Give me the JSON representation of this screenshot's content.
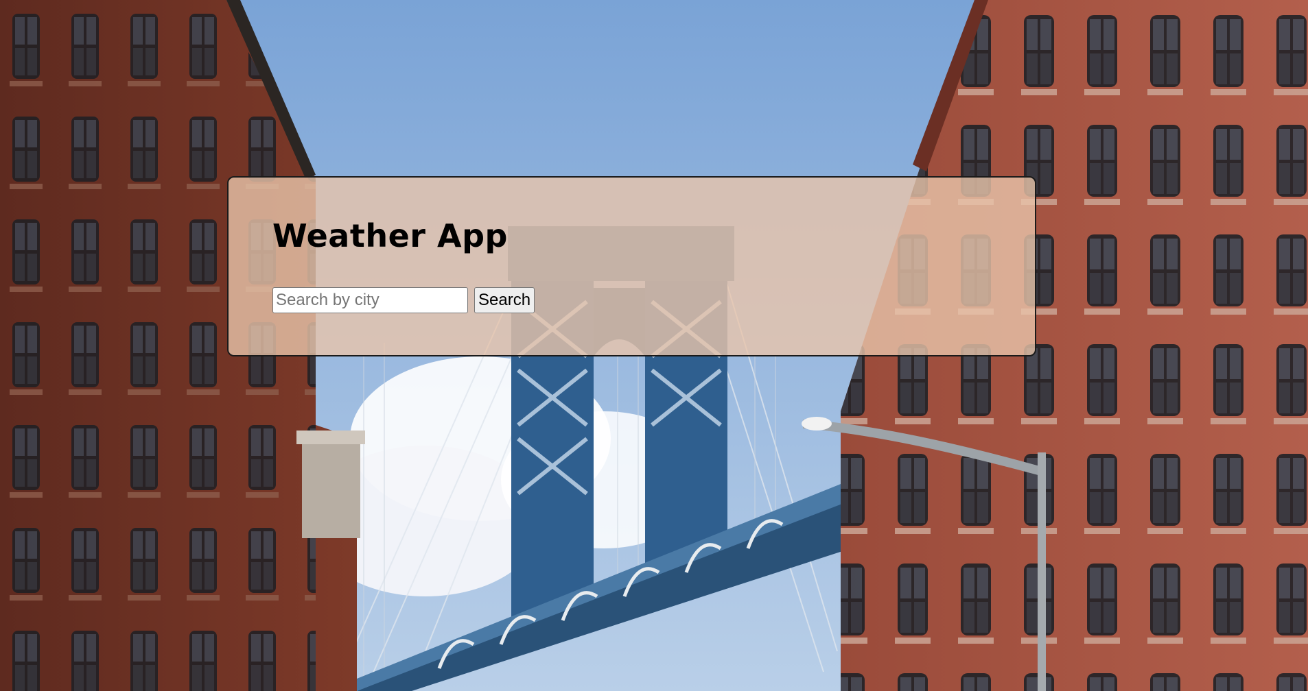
{
  "app": {
    "title": "Weather App"
  },
  "search": {
    "placeholder": "Search by city",
    "value": "",
    "button_label": "Search"
  },
  "colors": {
    "card_background": "#e9c4aa",
    "card_border": "#1a1a1a",
    "sky": "#8fb2d8",
    "brick": "#8a3d2c",
    "bridge_steel": "#2f5f8f"
  },
  "background": {
    "description_icon": "city-bridge-photo"
  }
}
